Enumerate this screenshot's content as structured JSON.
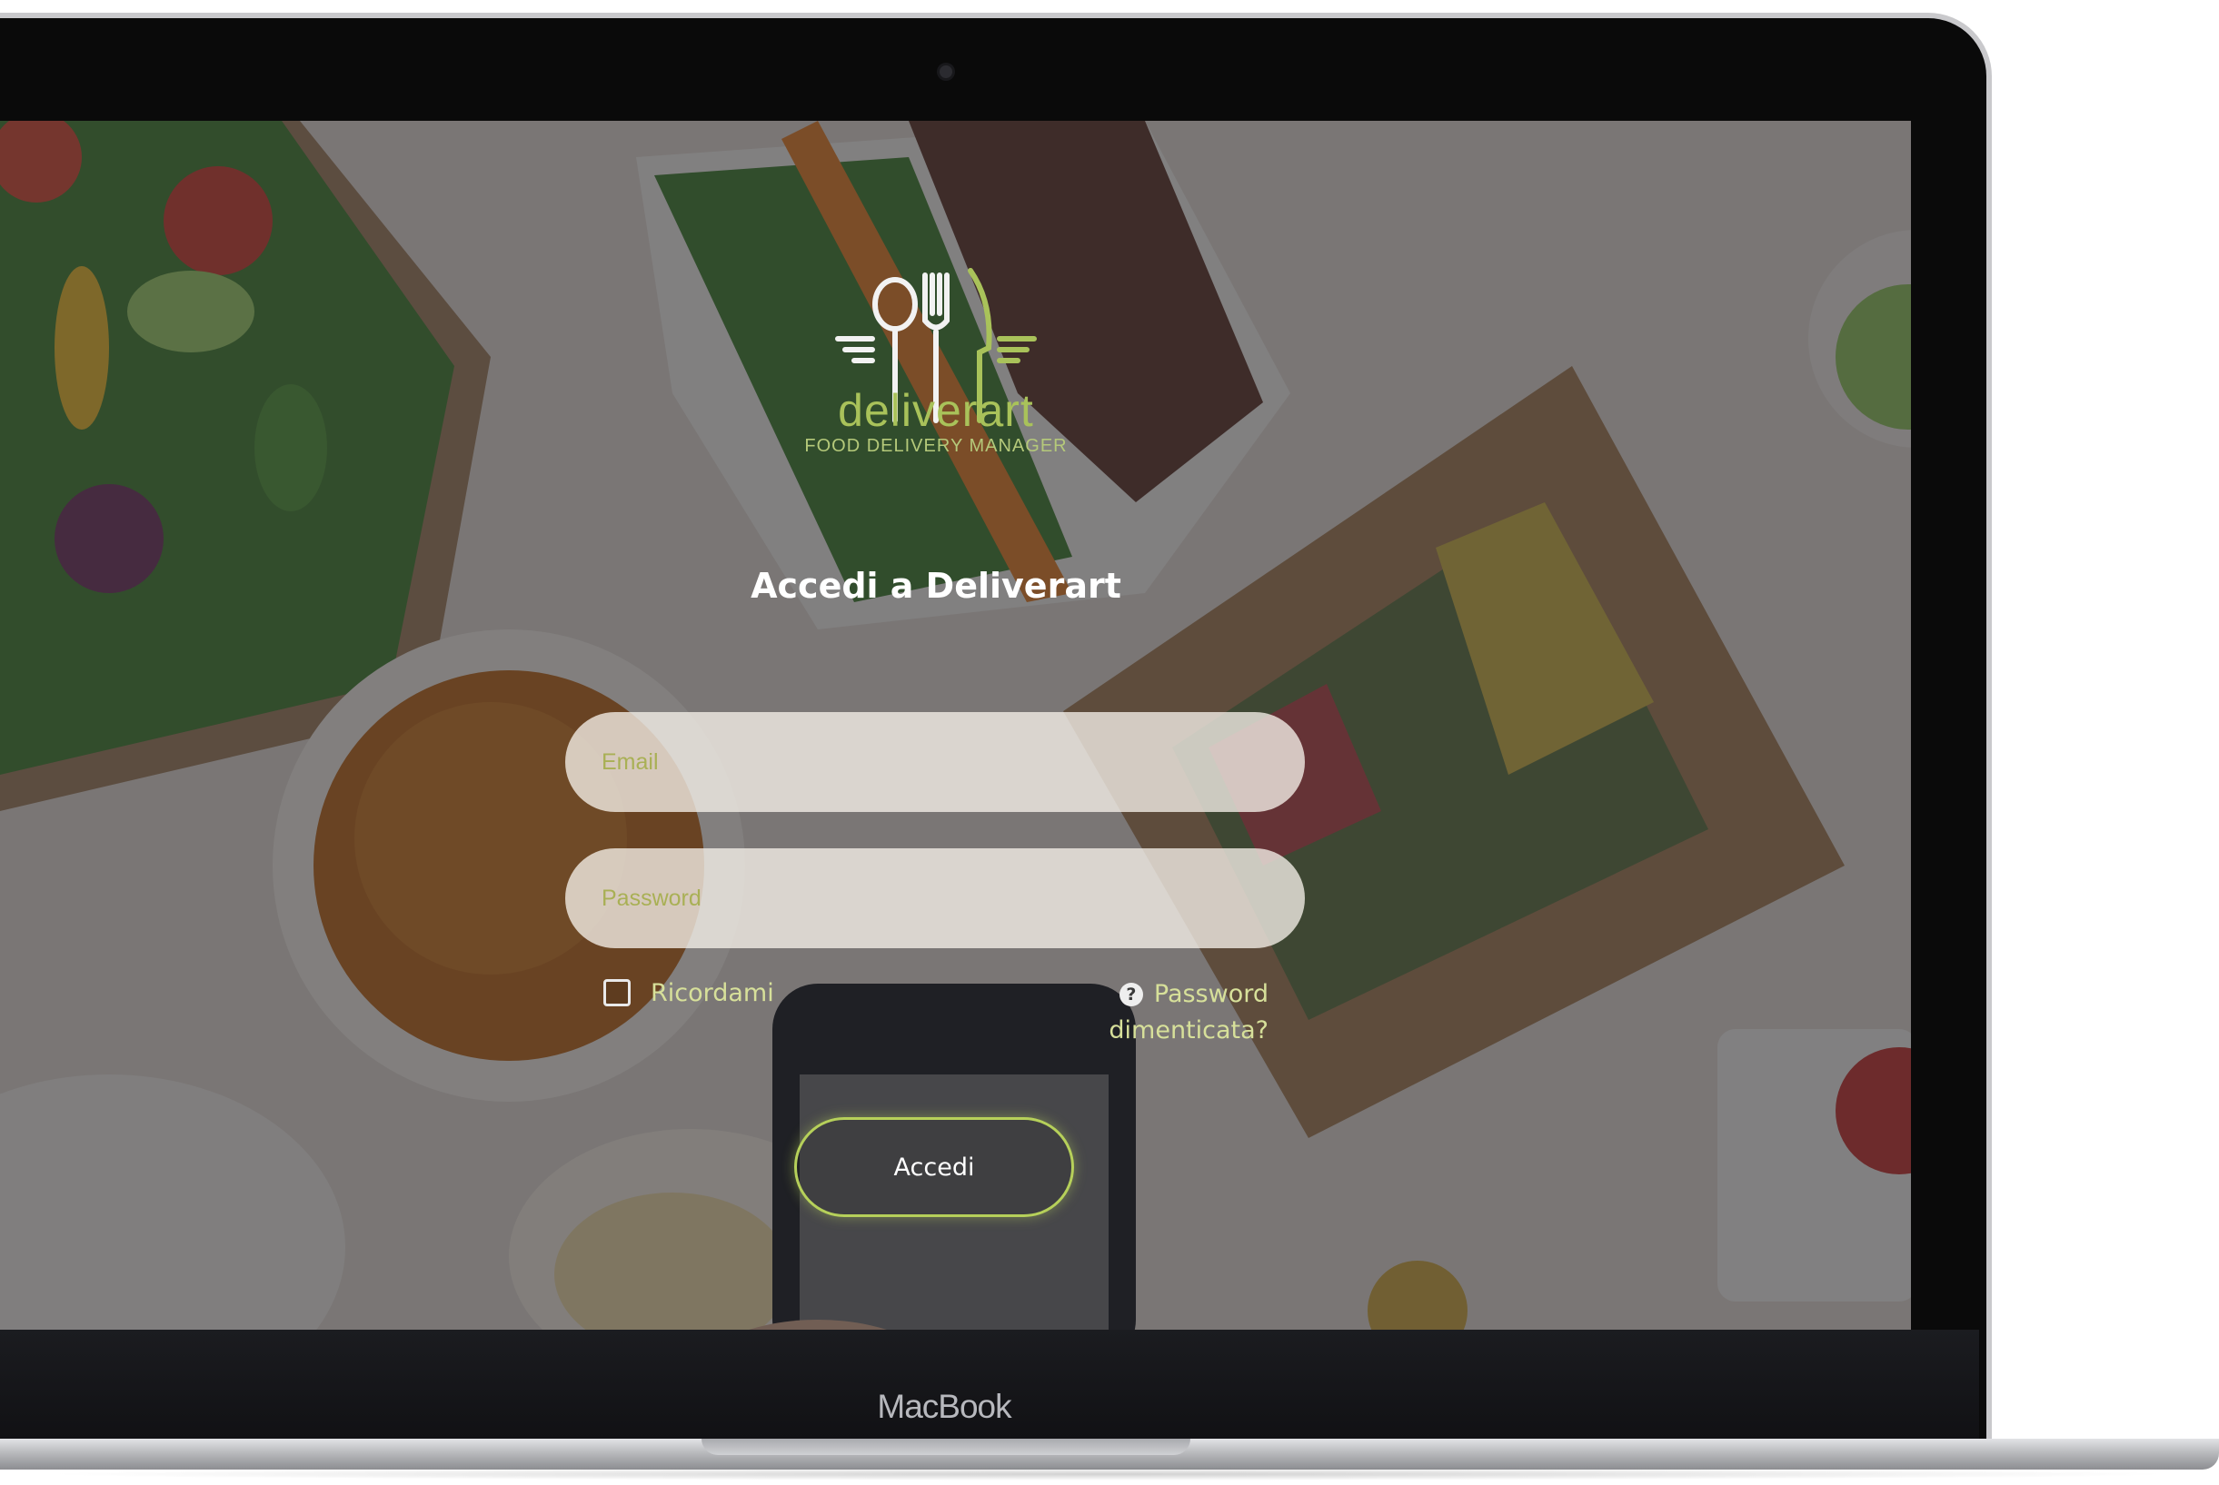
{
  "device": {
    "brand_label": "MacBook"
  },
  "app": {
    "logo_word": "deliverart",
    "logo_tagline": "FOOD DELIVERY MANAGER",
    "title": "Accedi a Deliverart"
  },
  "login_form": {
    "email_placeholder": "Email",
    "email_value": "",
    "password_placeholder": "Password",
    "password_value": "",
    "remember_label": "Ricordami",
    "remember_checked": false,
    "forgot_password_label": "Password dimenticata?",
    "submit_label": "Accedi"
  },
  "icons": {
    "logo": "cutlery-logo-icon",
    "help": "question-circle-icon",
    "checkbox": "checkbox-icon"
  },
  "colors": {
    "accent": "#b6d05a",
    "label_text": "#d7e09a",
    "title_text": "#ffffff"
  }
}
